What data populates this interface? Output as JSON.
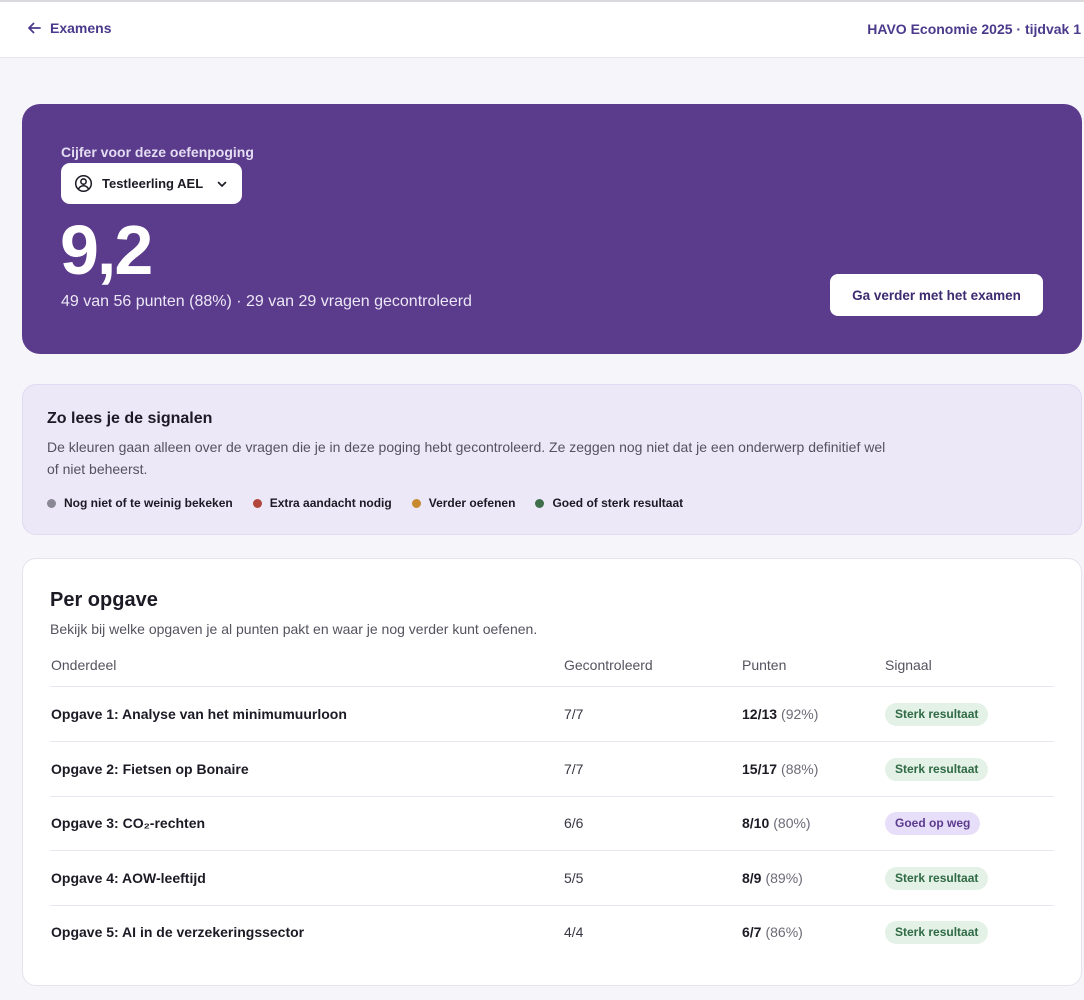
{
  "header": {
    "back_label": "Examens",
    "exam_title": "HAVO Economie 2025 · tijdvak 1"
  },
  "hero": {
    "label": "Cijfer voor deze oefenpoging",
    "student_name": "Testleerling AEL",
    "grade": "9,2",
    "score_line": "49 van 56 punten (88%) · 29 van 29 vragen gecontroleerd",
    "continue_label": "Ga verder met het examen"
  },
  "legend": {
    "title": "Zo lees je de signalen",
    "text": "De kleuren gaan alleen over de vragen die je in deze poging hebt gecontroleerd. Ze zeggen nog niet dat je een onderwerp definitief wel of niet beheerst.",
    "items": [
      {
        "label": "Nog niet of te weinig bekeken",
        "color": "#8a8894"
      },
      {
        "label": "Extra aandacht nodig",
        "color": "#b2453c"
      },
      {
        "label": "Verder oefenen",
        "color": "#c98a2e"
      },
      {
        "label": "Goed of sterk resultaat",
        "color": "#3f6e4b"
      }
    ]
  },
  "table": {
    "title": "Per opgave",
    "subtitle": "Bekijk bij welke opgaven je al punten pakt en waar je nog verder kunt oefenen.",
    "columns": [
      "Onderdeel",
      "Gecontroleerd",
      "Punten",
      "Signaal"
    ],
    "rows": [
      {
        "name": "Opgave 1: Analyse van het minimumuurloon",
        "checked": "7/7",
        "points": "12/13",
        "percent": "(92%)",
        "signal": "Sterk resultaat",
        "signal_type": "green"
      },
      {
        "name": "Opgave 2: Fietsen op Bonaire",
        "checked": "7/7",
        "points": "15/17",
        "percent": "(88%)",
        "signal": "Sterk resultaat",
        "signal_type": "green"
      },
      {
        "name": "Opgave 3: CO₂-rechten",
        "checked": "6/6",
        "points": "8/10",
        "percent": "(80%)",
        "signal": "Goed op weg",
        "signal_type": "purple"
      },
      {
        "name": "Opgave 4: AOW-leeftijd",
        "checked": "5/5",
        "points": "8/9",
        "percent": "(89%)",
        "signal": "Sterk resultaat",
        "signal_type": "green"
      },
      {
        "name": "Opgave 5: AI in de verzekeringssector",
        "checked": "4/4",
        "points": "6/7",
        "percent": "(86%)",
        "signal": "Sterk resultaat",
        "signal_type": "green"
      }
    ]
  }
}
